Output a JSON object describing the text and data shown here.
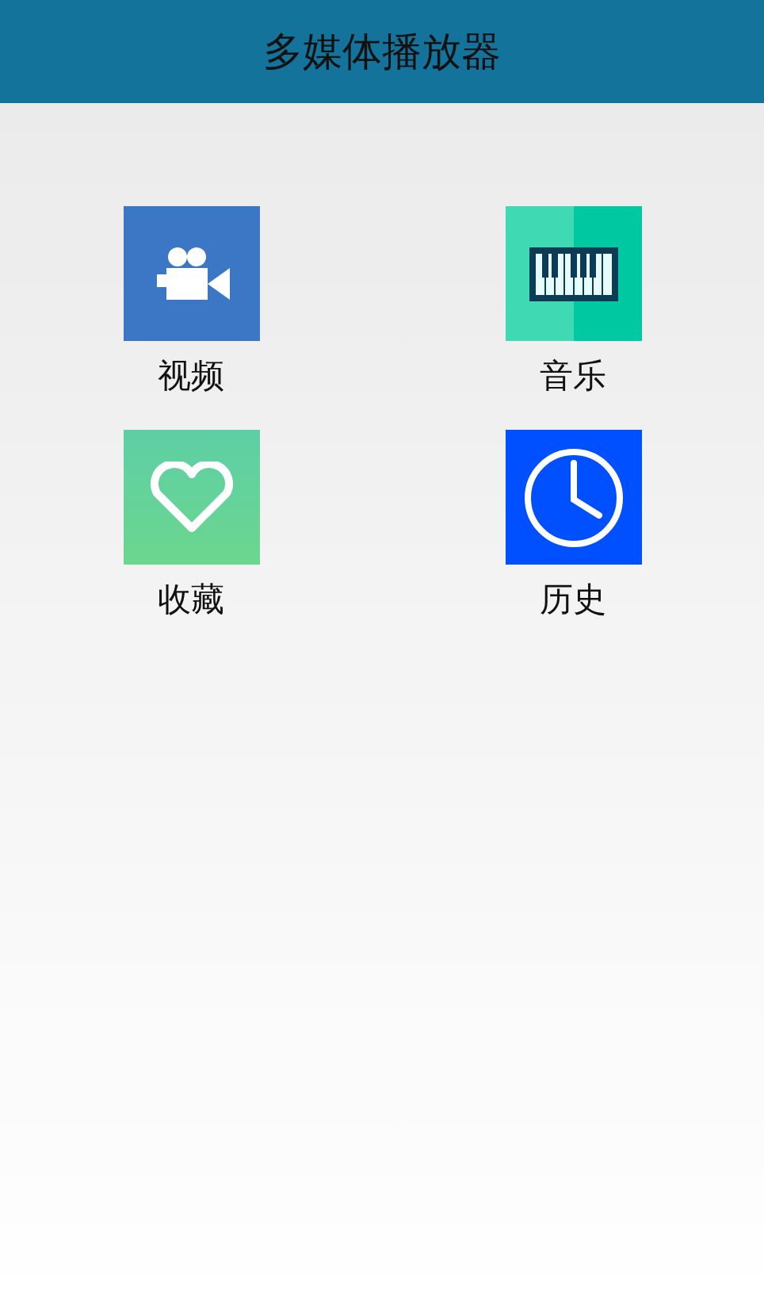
{
  "app_bar": {
    "title": "多媒体播放器"
  },
  "tiles": [
    {
      "kind": "video",
      "label": "视频"
    },
    {
      "kind": "music",
      "label": "音乐"
    },
    {
      "kind": "favorite",
      "label": "收藏"
    },
    {
      "kind": "history",
      "label": "历史"
    }
  ]
}
